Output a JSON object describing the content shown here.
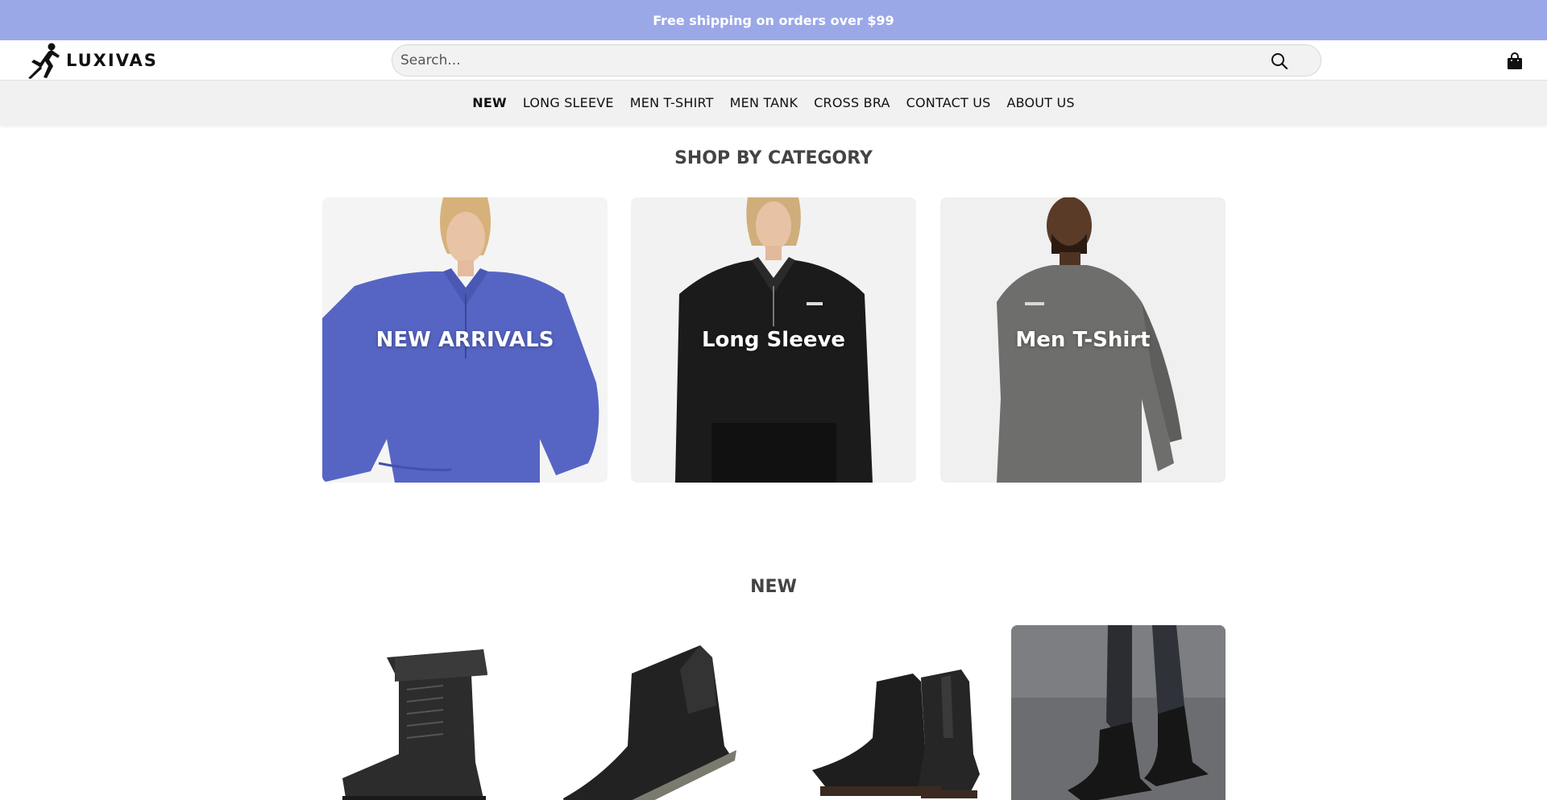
{
  "announcement": "Free shipping on orders over $99",
  "brand": {
    "name": "LUXIVAS"
  },
  "search": {
    "placeholder": "Search..."
  },
  "icons": {
    "search": "search-icon",
    "cart": "cart-icon",
    "logo": "runner-logo-icon"
  },
  "nav": {
    "items": [
      {
        "label": "NEW",
        "active": true
      },
      {
        "label": "LONG SLEEVE",
        "active": false
      },
      {
        "label": "MEN T-SHIRT",
        "active": false
      },
      {
        "label": "MEN TANK",
        "active": false
      },
      {
        "label": "CROSS BRA",
        "active": false
      },
      {
        "label": "CONTACT US",
        "active": false
      },
      {
        "label": "ABOUT US",
        "active": false
      }
    ]
  },
  "categories": {
    "title": "SHOP BY CATEGORY",
    "items": [
      {
        "label": "NEW ARRIVALS",
        "garment_color": "#5665c4"
      },
      {
        "label": "Long Sleeve",
        "garment_color": "#1a1a1a"
      },
      {
        "label": "Men T-Shirt",
        "garment_color": "#6e6e6c"
      }
    ]
  },
  "new_section": {
    "title": "NEW",
    "products": [
      {
        "name": "lace-up-boot"
      },
      {
        "name": "chelsea-boot"
      },
      {
        "name": "chelsea-boot-pair"
      },
      {
        "name": "boot-lifestyle-photo"
      }
    ]
  },
  "colors": {
    "announcement_bg": "#9ba8e8",
    "nav_bg": "#f1f1f1"
  }
}
